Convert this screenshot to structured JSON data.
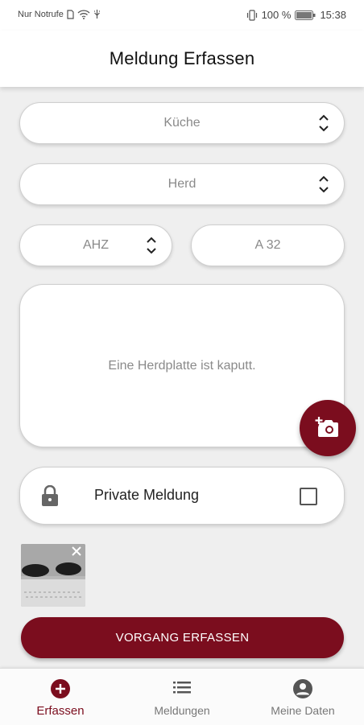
{
  "status_bar": {
    "carrier": "Nur Notrufe",
    "battery": "100 %",
    "time": "15:38"
  },
  "header": {
    "title": "Meldung Erfassen"
  },
  "form": {
    "room_select": {
      "value": "Küche"
    },
    "object_select": {
      "value": "Herd"
    },
    "building_select": {
      "value": "AHZ"
    },
    "unit_field": {
      "value": "A 32"
    },
    "description": {
      "value": "Eine Herdplatte ist kaputt."
    },
    "private": {
      "label": "Private Meldung",
      "checked": false
    }
  },
  "submit_button": {
    "label": "VORGANG ERFASSEN"
  },
  "bottom_nav": {
    "items": [
      {
        "label": "Erfassen",
        "icon": "add-circle-icon",
        "active": true
      },
      {
        "label": "Meldungen",
        "icon": "list-icon",
        "active": false
      },
      {
        "label": "Meine Daten",
        "icon": "account-circle-icon",
        "active": false
      }
    ]
  },
  "colors": {
    "accent": "#7b0d1e",
    "background": "#efefef",
    "field_text": "#8a8a8a"
  }
}
